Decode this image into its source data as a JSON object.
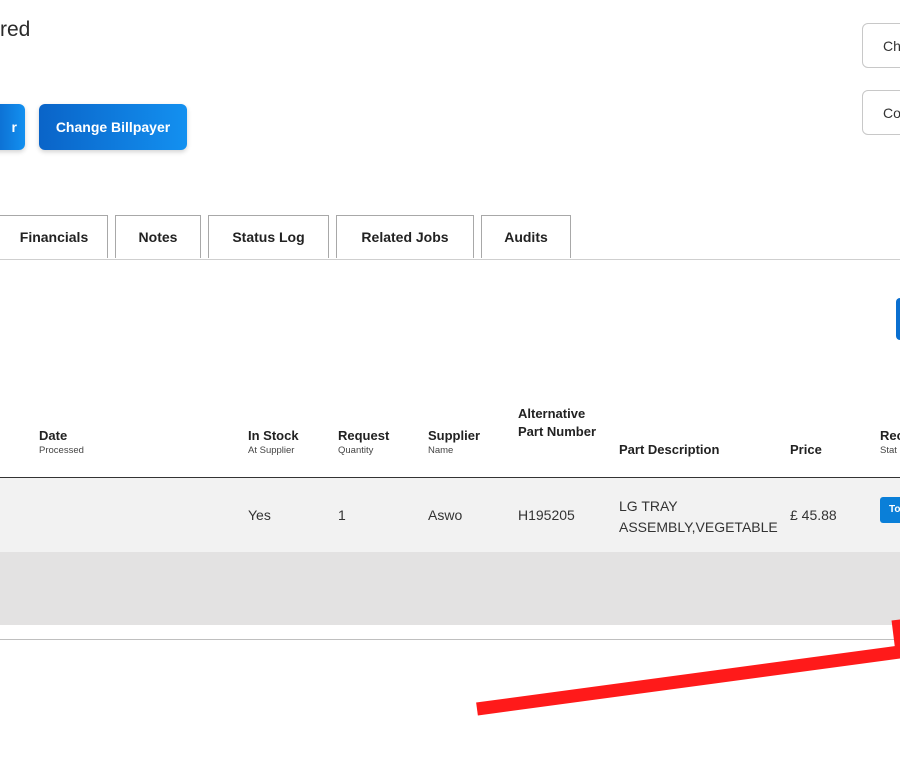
{
  "header": {
    "title_fragment": "red"
  },
  "actions": {
    "prev_button_label": "r",
    "change_billpayer_label": "Change Billpayer"
  },
  "right_buttons": {
    "top_label": "Ch",
    "bottom_label": "Co"
  },
  "tabs": [
    {
      "label": "Financials"
    },
    {
      "label": "Notes"
    },
    {
      "label": "Status Log"
    },
    {
      "label": "Related Jobs"
    },
    {
      "label": "Audits"
    }
  ],
  "table": {
    "columns": [
      {
        "label": "Date",
        "sub": "Processed"
      },
      {
        "label": "In Stock",
        "sub": "At Supplier"
      },
      {
        "label": "Request",
        "sub": "Quantity"
      },
      {
        "label": "Supplier",
        "sub": "Name"
      },
      {
        "label": "Alternative Part Number",
        "sub": ""
      },
      {
        "label": "Part Description",
        "sub": ""
      },
      {
        "label": "Price",
        "sub": ""
      },
      {
        "label": "Rec",
        "sub": "Stat"
      }
    ],
    "rows": [
      {
        "date_processed": "",
        "in_stock": "Yes",
        "quantity": "1",
        "supplier": "Aswo",
        "alt_part_number": "H195205",
        "description_line1": "LG TRAY",
        "description_line2": "ASSEMBLY,VEGETABLE",
        "price": "£ 45.88",
        "status_badge": "To"
      }
    ]
  },
  "colors": {
    "accent": "#0a6fd0",
    "annotation_arrow": "#ff1a1a"
  },
  "icons": {
    "annotation": "red-arrow-annotation"
  }
}
